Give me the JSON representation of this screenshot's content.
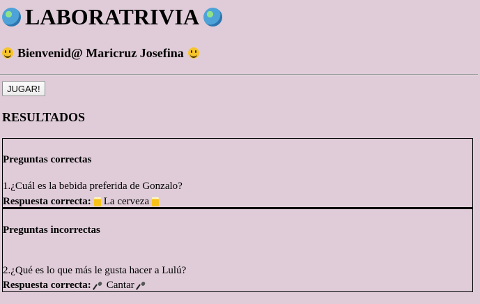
{
  "header": {
    "title": "LABORATRIVIA",
    "welcome": "Bienvenid@ Maricruz Josefina"
  },
  "actions": {
    "play_label": "JUGAR!"
  },
  "results": {
    "heading": "RESULTADOS",
    "correct": {
      "title": "Preguntas correctas",
      "question": "1.¿Cuál es la bebida preferida de Gonzalo?",
      "answer_label": "Respuesta correcta:",
      "answer_value": "La cerveza"
    },
    "incorrect": {
      "title": "Preguntas incorrectas",
      "question": "2.¿Qué es lo que más le gusta hacer a Lulú?",
      "answer_label": "Respuesta correcta:",
      "answer_value": "Cantar"
    }
  }
}
